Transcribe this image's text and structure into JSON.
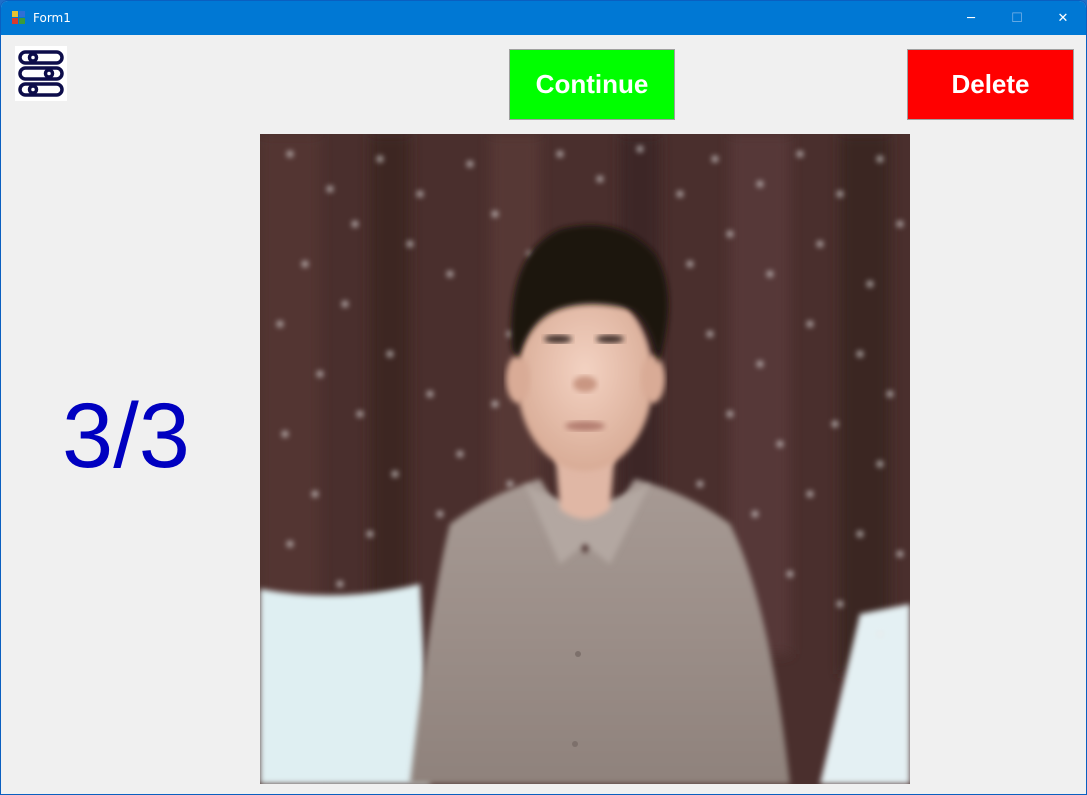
{
  "window": {
    "title": "Form1",
    "controls": {
      "minimize": "─",
      "maximize": "☐",
      "close": "✕"
    }
  },
  "toolbar": {
    "settings_icon": "settings-sliders-icon",
    "continue_label": "Continue",
    "delete_label": "Delete"
  },
  "counter": {
    "text": "3/3"
  },
  "colors": {
    "titlebar": "#0078d4",
    "continue": "#00ff00",
    "delete": "#ff0000",
    "counter": "#0000c0"
  }
}
